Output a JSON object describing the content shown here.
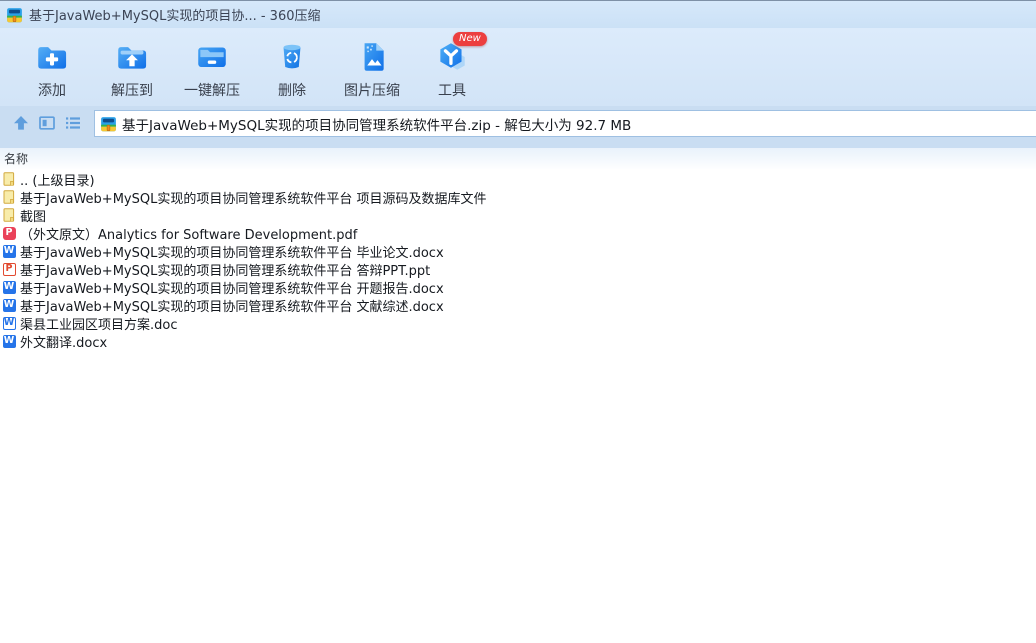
{
  "colors": {
    "accent_blue": "#1677e0",
    "titlebar_bg": "#cfe3f7",
    "toolbar_bg": "#d6e7f9",
    "address_row_bg": "#c9ddf2",
    "badge_red": "#ec3f3f",
    "folder_yellow": "#f8ecaa",
    "word_blue": "#2574e9",
    "ppt_red": "#e24a30",
    "pdf_red": "#ea4159"
  },
  "titlebar": {
    "title": "基于JavaWeb+MySQL实现的项目协... - 360压缩",
    "app_icon": "zip-archive-icon"
  },
  "toolbar": {
    "items": [
      {
        "label": "添加",
        "icon": "add-folder-icon"
      },
      {
        "label": "解压到",
        "icon": "extract-to-icon"
      },
      {
        "label": "一键解压",
        "icon": "one-click-extract-icon"
      },
      {
        "label": "删除",
        "icon": "delete-trash-icon"
      },
      {
        "label": "图片压缩",
        "icon": "image-compress-icon"
      },
      {
        "label": "工具",
        "icon": "tools-cube-icon",
        "badge": "New"
      }
    ]
  },
  "addressbar": {
    "path": "基于JavaWeb+MySQL实现的项目协同管理系统软件平台.zip - 解包大小为 92.7 MB",
    "nav_icons": [
      "up-arrow-icon",
      "view-mode-icon",
      "list-view-icon"
    ]
  },
  "filelist": {
    "column_header": "名称",
    "rows": [
      {
        "name": ".. (上级目录)",
        "icon": "folder"
      },
      {
        "name": "基于JavaWeb+MySQL实现的项目协同管理系统软件平台 项目源码及数据库文件",
        "icon": "folder"
      },
      {
        "name": "截图",
        "icon": "folder"
      },
      {
        "name": "（外文原文）Analytics for Software Development.pdf",
        "icon": "pdf"
      },
      {
        "name": "基于JavaWeb+MySQL实现的项目协同管理系统软件平台 毕业论文.docx",
        "icon": "word"
      },
      {
        "name": "基于JavaWeb+MySQL实现的项目协同管理系统软件平台 答辩PPT.ppt",
        "icon": "ppt"
      },
      {
        "name": "基于JavaWeb+MySQL实现的项目协同管理系统软件平台 开题报告.docx",
        "icon": "word"
      },
      {
        "name": "基于JavaWeb+MySQL实现的项目协同管理系统软件平台 文献综述.docx",
        "icon": "word"
      },
      {
        "name": "渠县工业园区项目方案.doc",
        "icon": "word-outline"
      },
      {
        "name": "外文翻译.docx",
        "icon": "word"
      }
    ]
  },
  "icons": {
    "word_letter": "W",
    "ppt_letter": "P",
    "pdf_letter": "P"
  }
}
